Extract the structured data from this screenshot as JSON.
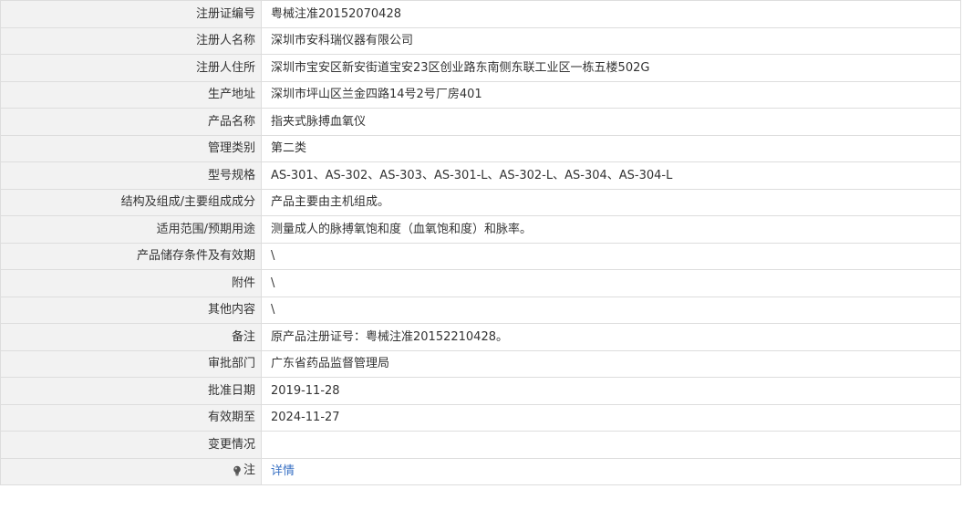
{
  "rows": [
    {
      "label": "注册证编号",
      "value": "粤械注准20152070428"
    },
    {
      "label": "注册人名称",
      "value": "深圳市安科瑞仪器有限公司"
    },
    {
      "label": "注册人住所",
      "value": "深圳市宝安区新安街道宝安23区创业路东南侧东联工业区一栋五楼502G"
    },
    {
      "label": "生产地址",
      "value": "深圳市坪山区兰金四路14号2号厂房401"
    },
    {
      "label": "产品名称",
      "value": "指夹式脉搏血氧仪"
    },
    {
      "label": "管理类别",
      "value": "第二类"
    },
    {
      "label": "型号规格",
      "value": "AS-301、AS-302、AS-303、AS-301-L、AS-302-L、AS-304、AS-304-L"
    },
    {
      "label": "结构及组成/主要组成成分",
      "value": "产品主要由主机组成。"
    },
    {
      "label": "适用范围/预期用途",
      "value": "测量成人的脉搏氧饱和度（血氧饱和度）和脉率。"
    },
    {
      "label": "产品储存条件及有效期",
      "value": "\\"
    },
    {
      "label": "附件",
      "value": "\\"
    },
    {
      "label": "其他内容",
      "value": "\\"
    },
    {
      "label": "备注",
      "value": "原产品注册证号：粤械注准20152210428。"
    },
    {
      "label": "审批部门",
      "value": "广东省药品监督管理局"
    },
    {
      "label": "批准日期",
      "value": "2019-11-28"
    },
    {
      "label": "有效期至",
      "value": "2024-11-27"
    },
    {
      "label": "变更情况",
      "value": ""
    }
  ],
  "note": {
    "label": "注",
    "link_text": "详情",
    "icon": "lightbulb-icon"
  },
  "colors": {
    "label_bg": "#f2f2f2",
    "border": "#dddddd",
    "text": "#333333",
    "link": "#3a72c4"
  }
}
